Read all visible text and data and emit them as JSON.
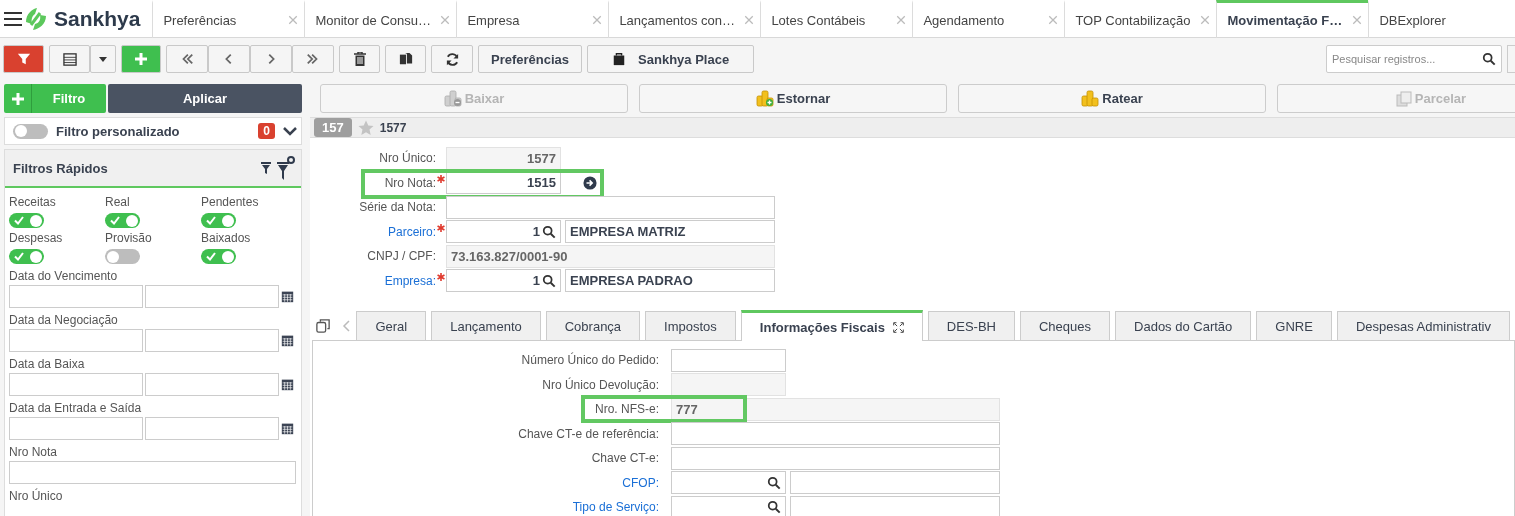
{
  "logo_text": "Sankhya",
  "top_tabs": [
    {
      "label": "Preferências",
      "selected": false,
      "closable": true
    },
    {
      "label": "Monitor de Consu…",
      "selected": false,
      "closable": true
    },
    {
      "label": "Empresa",
      "selected": false,
      "closable": true
    },
    {
      "label": "Lançamentos con…",
      "selected": false,
      "closable": true
    },
    {
      "label": "Lotes Contábeis",
      "selected": false,
      "closable": true
    },
    {
      "label": "Agendamento",
      "selected": false,
      "closable": true
    },
    {
      "label": "TOP Contabilização",
      "selected": false,
      "closable": true
    },
    {
      "label": "Movimentação F…",
      "selected": true,
      "closable": true
    },
    {
      "label": "DBExplorer",
      "selected": false,
      "closable": false
    }
  ],
  "toolbar": {
    "text_buttons": [
      {
        "label": "Preferências",
        "kind": "plain"
      },
      {
        "label": "Sankhya Place",
        "kind": "bag"
      }
    ],
    "search": {
      "placeholder": "Pesquisar registros..."
    }
  },
  "filter_panel": {
    "add_button": "Filtro",
    "apply_button": "Aplicar",
    "custom_filter": {
      "label": "Filtro personalizado",
      "on": false,
      "count": "0"
    },
    "title": "Filtros Rápidos",
    "toggles": [
      {
        "label": "Receitas",
        "on": true
      },
      {
        "label": "Real",
        "on": true
      },
      {
        "label": "Pendentes",
        "on": true
      },
      {
        "label": "Despesas",
        "on": true
      },
      {
        "label": "Provisão",
        "on": false
      },
      {
        "label": "Baixados",
        "on": true
      }
    ],
    "date_ranges": [
      "Data do Vencimento",
      "Data da Negociação",
      "Data da Baixa",
      "Data da Entrada e Saída"
    ],
    "text_filters": [
      {
        "label": "Nro Nota",
        "kind": "text"
      },
      {
        "label": "Nro Único",
        "kind": "heading"
      }
    ]
  },
  "actions": [
    {
      "label": "Baixar",
      "disabled": true,
      "kind": "coins-minus"
    },
    {
      "label": "Estornar",
      "disabled": false,
      "kind": "coins-plus"
    },
    {
      "label": "Ratear",
      "disabled": false,
      "kind": "coins"
    },
    {
      "label": "Parcelar",
      "disabled": true,
      "kind": "pages"
    }
  ],
  "record": {
    "badge": "157",
    "favorite": false,
    "title": "1577"
  },
  "form": {
    "fields": [
      {
        "label": "Nro Único:",
        "kind": "short_readonly",
        "value": "1577",
        "required": false,
        "link": false,
        "highlighted": false
      },
      {
        "label": "Nro Nota:",
        "kind": "navigate",
        "value": "1515",
        "required": true,
        "link": false,
        "highlighted": true
      },
      {
        "label": "Série da Nota:",
        "kind": "wide",
        "required": false,
        "link": false,
        "highlighted": false
      },
      {
        "label": "Parceiro:",
        "kind": "lookup",
        "value": "1",
        "description": "EMPRESA MATRIZ",
        "required": true,
        "link": true,
        "highlighted": false
      },
      {
        "label": "CNPJ / CPF:",
        "kind": "wide_readonly",
        "value": "73.163.827/0001-90",
        "required": false,
        "link": false,
        "highlighted": false
      },
      {
        "label": "Empresa:",
        "kind": "lookup",
        "value": "1",
        "description": "EMPRESA PADRAO",
        "required": true,
        "link": true,
        "highlighted": false
      }
    ]
  },
  "detail_tabs": [
    {
      "label": "Geral",
      "selected": false
    },
    {
      "label": "Lançamento",
      "selected": false
    },
    {
      "label": "Cobrança",
      "selected": false
    },
    {
      "label": "Impostos",
      "selected": false
    },
    {
      "label": "Informações Fiscais",
      "selected": true
    },
    {
      "label": "DES-BH",
      "selected": false
    },
    {
      "label": "Cheques",
      "selected": false
    },
    {
      "label": "Dados do Cartão",
      "selected": false
    },
    {
      "label": "GNRE",
      "selected": false
    },
    {
      "label": "Despesas Administrativ",
      "selected": false
    }
  ],
  "fiscal_fields": [
    {
      "label": "Número Único do Pedido:",
      "kind": "short",
      "link": false,
      "highlighted": false
    },
    {
      "label": "Nro Único Devolução:",
      "kind": "short_readonly",
      "link": false,
      "highlighted": false
    },
    {
      "label": "Nro. NFS-e:",
      "kind": "wide_readonly",
      "value": "777",
      "link": false,
      "highlighted": true
    },
    {
      "label": "Chave CT-e de referência:",
      "kind": "wide",
      "link": false,
      "highlighted": false
    },
    {
      "label": "Chave CT-e:",
      "kind": "wide",
      "link": false,
      "highlighted": false
    },
    {
      "label": "CFOP:",
      "kind": "lookup",
      "link": true,
      "highlighted": false
    },
    {
      "label": "Tipo de Serviço:",
      "kind": "lookup",
      "link": true,
      "highlighted": false
    }
  ]
}
